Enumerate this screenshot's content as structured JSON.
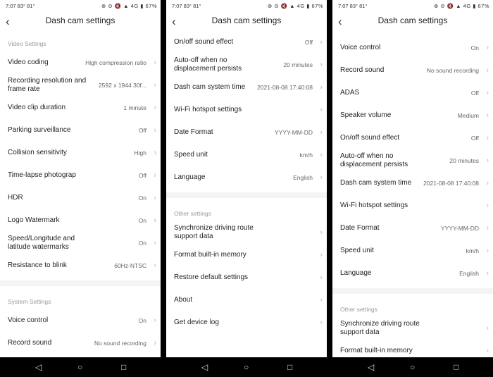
{
  "status": {
    "time": "7:07 83° 81°",
    "icons": "⊕ ⊖ 🔇 ▲ 4G ▮",
    "battery": "67%"
  },
  "title": "Dash cam settings",
  "phone1": {
    "section_video": "Video Settings",
    "section_system": "System Settings",
    "rows": [
      {
        "label": "Video coding",
        "value": "High compression ratio"
      },
      {
        "label": "Recording resolution and frame rate",
        "value": "2592 x 1944 30f..."
      },
      {
        "label": "Video clip duration",
        "value": "1 minute"
      },
      {
        "label": "Parking surveillance",
        "value": "Off"
      },
      {
        "label": "Collision sensitivity",
        "value": "High"
      },
      {
        "label": "Time-lapse photograp",
        "value": "Off"
      },
      {
        "label": "HDR",
        "value": "On"
      },
      {
        "label": "Logo Watermark",
        "value": "On"
      },
      {
        "label": "Speed/Longitude and latitude watermarks",
        "value": "On"
      },
      {
        "label": "Resistance to blink",
        "value": "60Hz-NTSC"
      },
      {
        "label": "Voice control",
        "value": "On"
      },
      {
        "label": "Record sound",
        "value": "No sound recording"
      }
    ]
  },
  "phone2": {
    "section_other": "Other settings",
    "rows": [
      {
        "label": "On/off sound effect",
        "value": "Off"
      },
      {
        "label": "Auto-off when no displacement persists",
        "value": "20 minutes"
      },
      {
        "label": "Dash cam system time",
        "value": "2021-08-08 17:40:08"
      },
      {
        "label": "Wi-Fi hotspot settings",
        "value": ""
      },
      {
        "label": "Date Format",
        "value": "YYYY-MM-DD"
      },
      {
        "label": "Speed unit",
        "value": "km/h"
      },
      {
        "label": "Language",
        "value": "English"
      },
      {
        "label": "Synchronize driving route support data",
        "value": ""
      },
      {
        "label": "Format built-in memory",
        "value": ""
      },
      {
        "label": "Restore default settings",
        "value": ""
      },
      {
        "label": "About",
        "value": ""
      },
      {
        "label": "Get device log",
        "value": ""
      }
    ]
  },
  "phone3": {
    "section_other": "Other settings",
    "rows": [
      {
        "label": "Voice control",
        "value": "On"
      },
      {
        "label": "Record sound",
        "value": "No sound recording"
      },
      {
        "label": "ADAS",
        "value": "Off"
      },
      {
        "label": "Speaker volume",
        "value": "Medium"
      },
      {
        "label": "On/off sound effect",
        "value": "Off"
      },
      {
        "label": "Auto-off when no displacement persists",
        "value": "20 minutes"
      },
      {
        "label": "Dash cam system time",
        "value": "2021-08-08 17:40:08"
      },
      {
        "label": "Wi-Fi hotspot settings",
        "value": ""
      },
      {
        "label": "Date Format",
        "value": "YYYY-MM-DD"
      },
      {
        "label": "Speed unit",
        "value": "km/h"
      },
      {
        "label": "Language",
        "value": "English"
      },
      {
        "label": "Synchronize driving route support data",
        "value": ""
      },
      {
        "label": "Format built-in memory",
        "value": ""
      }
    ]
  },
  "icons": {
    "back": "chevron-left-icon",
    "chevron": "chevron-right-icon",
    "nav_back": "triangle-back-icon",
    "nav_home": "circle-home-icon",
    "nav_recents": "square-recents-icon"
  }
}
